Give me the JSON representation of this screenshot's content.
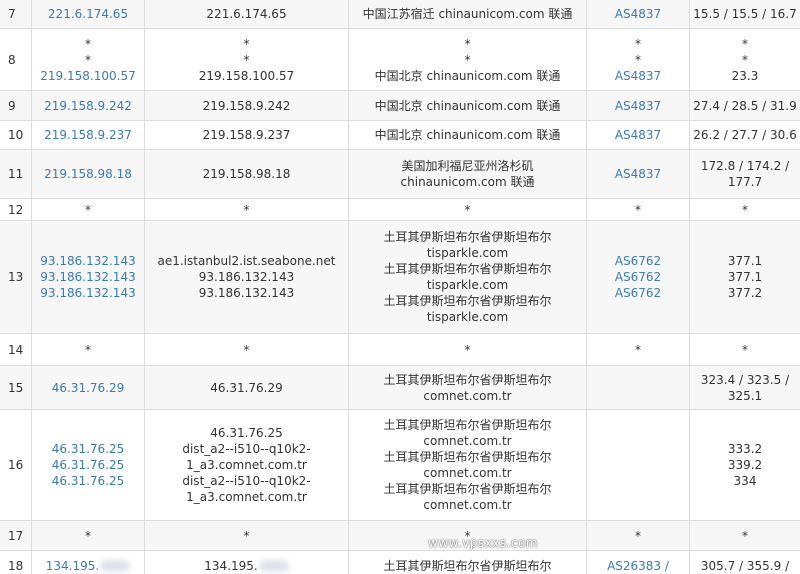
{
  "rows": [
    {
      "hop": "7",
      "ips": [
        "221.6.174.65"
      ],
      "hosts": [
        "221.6.174.65"
      ],
      "locs": [
        "中国江苏宿迁 chinaunicom.com 联通"
      ],
      "as": [
        "AS4837"
      ],
      "rtt": [
        "15.5 / 15.5 / 16.7"
      ]
    },
    {
      "hop": "8",
      "ips": [
        "*",
        "*",
        "219.158.100.57"
      ],
      "hosts": [
        "*",
        "*",
        "219.158.100.57"
      ],
      "locs": [
        "*",
        "*",
        "中国北京 chinaunicom.com 联通"
      ],
      "as": [
        "*",
        "*",
        "AS4837"
      ],
      "rtt": [
        "*",
        "*",
        "23.3"
      ]
    },
    {
      "hop": "9",
      "ips": [
        "219.158.9.242"
      ],
      "hosts": [
        "219.158.9.242"
      ],
      "locs": [
        "中国北京 chinaunicom.com 联通"
      ],
      "as": [
        "AS4837"
      ],
      "rtt": [
        "27.4 / 28.5 / 31.9"
      ]
    },
    {
      "hop": "10",
      "ips": [
        "219.158.9.237"
      ],
      "hosts": [
        "219.158.9.237"
      ],
      "locs": [
        "中国北京 chinaunicom.com 联通"
      ],
      "as": [
        "AS4837"
      ],
      "rtt": [
        "26.2 / 27.7 / 30.6"
      ]
    },
    {
      "hop": "11",
      "ips": [
        "219.158.98.18"
      ],
      "hosts": [
        "219.158.98.18"
      ],
      "locs": [
        "美国加利福尼亚州洛杉矶",
        "chinaunicom.com 联通"
      ],
      "as": [
        "AS4837"
      ],
      "rtt": [
        "172.8 / 174.2 /",
        "177.7"
      ]
    },
    {
      "hop": "12",
      "ips": [
        "*"
      ],
      "hosts": [
        "*"
      ],
      "locs": [
        "*"
      ],
      "as": [
        "*"
      ],
      "rtt": [
        "*"
      ]
    },
    {
      "hop": "13",
      "ips": [
        "93.186.132.143",
        "93.186.132.143",
        "93.186.132.143"
      ],
      "hosts": [
        "ae1.istanbul2.ist.seabone.net",
        "93.186.132.143",
        "93.186.132.143"
      ],
      "locs": [
        "土耳其伊斯坦布尔省伊斯坦布尔",
        "tisparkle.com",
        "土耳其伊斯坦布尔省伊斯坦布尔",
        "tisparkle.com",
        "土耳其伊斯坦布尔省伊斯坦布尔",
        "tisparkle.com"
      ],
      "as": [
        "AS6762",
        "AS6762",
        "AS6762"
      ],
      "rtt": [
        "377.1",
        "377.1",
        "377.2"
      ]
    },
    {
      "hop": "14",
      "ips": [
        "*"
      ],
      "hosts": [
        "*"
      ],
      "locs": [
        "*"
      ],
      "as": [
        "*"
      ],
      "rtt": [
        "*"
      ]
    },
    {
      "hop": "15",
      "ips": [
        "46.31.76.29"
      ],
      "hosts": [
        "46.31.76.29"
      ],
      "locs": [
        "土耳其伊斯坦布尔省伊斯坦布尔",
        "comnet.com.tr"
      ],
      "as": [],
      "rtt": [
        "323.4 / 323.5 /",
        "325.1"
      ]
    },
    {
      "hop": "16",
      "ips": [
        "46.31.76.25",
        "46.31.76.25",
        "46.31.76.25"
      ],
      "hosts": [
        "46.31.76.25",
        "dist_a2--i510--q10k2-",
        "1_a3.comnet.com.tr",
        "dist_a2--i510--q10k2-",
        "1_a3.comnet.com.tr"
      ],
      "locs": [
        "土耳其伊斯坦布尔省伊斯坦布尔",
        "comnet.com.tr",
        "土耳其伊斯坦布尔省伊斯坦布尔",
        "comnet.com.tr",
        "土耳其伊斯坦布尔省伊斯坦布尔",
        "comnet.com.tr"
      ],
      "as": [],
      "rtt": [
        "333.2",
        "339.2",
        "334"
      ]
    },
    {
      "hop": "17",
      "ips": [
        "*"
      ],
      "hosts": [
        "*"
      ],
      "locs": [
        "*"
      ],
      "as": [
        "*"
      ],
      "rtt": [
        "*"
      ]
    },
    {
      "hop": "18",
      "ips": [
        "134.195."
      ],
      "hosts": [
        "134.195."
      ],
      "locs": [
        "土耳其伊斯坦布尔省伊斯坦布尔"
      ],
      "as": [
        "AS26383 /"
      ],
      "rtt": [
        "305.7 / 355.9 /"
      ]
    }
  ],
  "watermark": "www.vpsxxs.com"
}
